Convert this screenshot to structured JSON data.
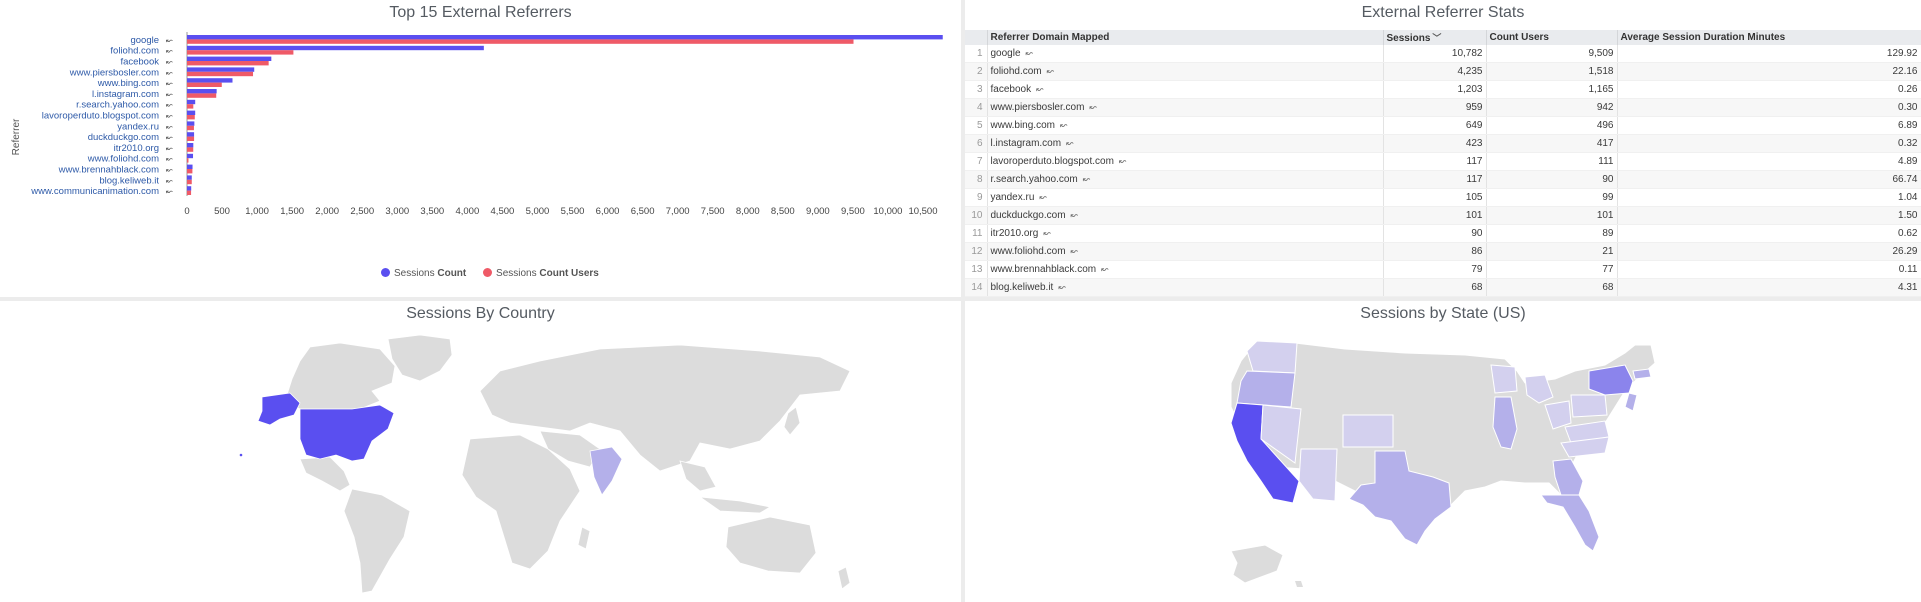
{
  "referrers_tile": {
    "title": "Top 15 External Referrers",
    "y_axis_label": "Referrer",
    "legend": [
      {
        "prefix": "Sessions",
        "bold": "Count",
        "color": "#5a4ff0"
      },
      {
        "prefix": "Sessions",
        "bold": "Count Users",
        "color": "#ef5a67"
      }
    ]
  },
  "chart_data": {
    "type": "bar",
    "orientation": "horizontal",
    "ylabel": "Referrer",
    "xlim": [
      0,
      10800
    ],
    "x_ticks": [
      "0",
      "500",
      "1,000",
      "1,500",
      "2,000",
      "2,500",
      "3,000",
      "3,500",
      "4,000",
      "4,500",
      "5,000",
      "5,500",
      "6,000",
      "6,500",
      "7,000",
      "7,500",
      "8,000",
      "8,500",
      "9,000",
      "9,500",
      "10,000",
      "10,500"
    ],
    "categories": [
      "google",
      "foliohd.com",
      "facebook",
      "www.piersbosler.com",
      "www.bing.com",
      "l.instagram.com",
      "r.search.yahoo.com",
      "lavoroperduto.blogspot.com",
      "yandex.ru",
      "duckduckgo.com",
      "itr2010.org",
      "www.foliohd.com",
      "www.brennahblack.com",
      "blog.keliweb.it",
      "www.communicanimation.com"
    ],
    "series": [
      {
        "name": "Sessions Count",
        "color": "#5a4ff0",
        "values": [
          10782,
          4235,
          1203,
          959,
          649,
          423,
          117,
          117,
          105,
          101,
          90,
          86,
          79,
          68,
          60
        ]
      },
      {
        "name": "Sessions Count Users",
        "color": "#ef5a67",
        "values": [
          9509,
          1518,
          1165,
          942,
          496,
          417,
          90,
          111,
          99,
          101,
          89,
          21,
          77,
          68,
          58
        ]
      }
    ]
  },
  "table_tile": {
    "title": "External Referrer Stats",
    "columns": [
      "Referrer Domain Mapped",
      "Sessions",
      "Count Users",
      "Average Session Duration Minutes"
    ],
    "rows": [
      {
        "idx": "1",
        "domain": "google",
        "sessions": "10,782",
        "users": "9,509",
        "avg": "129.92"
      },
      {
        "idx": "2",
        "domain": "foliohd.com",
        "sessions": "4,235",
        "users": "1,518",
        "avg": "22.16"
      },
      {
        "idx": "3",
        "domain": "facebook",
        "sessions": "1,203",
        "users": "1,165",
        "avg": "0.26"
      },
      {
        "idx": "4",
        "domain": "www.piersbosler.com",
        "sessions": "959",
        "users": "942",
        "avg": "0.30"
      },
      {
        "idx": "5",
        "domain": "www.bing.com",
        "sessions": "649",
        "users": "496",
        "avg": "6.89"
      },
      {
        "idx": "6",
        "domain": "l.instagram.com",
        "sessions": "423",
        "users": "417",
        "avg": "0.32"
      },
      {
        "idx": "7",
        "domain": "lavoroperduto.blogspot.com",
        "sessions": "117",
        "users": "111",
        "avg": "4.89"
      },
      {
        "idx": "8",
        "domain": "r.search.yahoo.com",
        "sessions": "117",
        "users": "90",
        "avg": "66.74"
      },
      {
        "idx": "9",
        "domain": "yandex.ru",
        "sessions": "105",
        "users": "99",
        "avg": "1.04"
      },
      {
        "idx": "10",
        "domain": "duckduckgo.com",
        "sessions": "101",
        "users": "101",
        "avg": "1.50"
      },
      {
        "idx": "11",
        "domain": "itr2010.org",
        "sessions": "90",
        "users": "89",
        "avg": "0.62"
      },
      {
        "idx": "12",
        "domain": "www.foliohd.com",
        "sessions": "86",
        "users": "21",
        "avg": "26.29"
      },
      {
        "idx": "13",
        "domain": "www.brennahblack.com",
        "sessions": "79",
        "users": "77",
        "avg": "0.11"
      },
      {
        "idx": "14",
        "domain": "blog.keliweb.it",
        "sessions": "68",
        "users": "68",
        "avg": "4.31"
      }
    ]
  },
  "country_tile": {
    "title": "Sessions By Country",
    "highlight_color": "#5a4ff0",
    "light_color": "#b4b0ea",
    "base_color": "#dcdcdc"
  },
  "state_tile": {
    "title": "Sessions by State (US)",
    "high_color": "#5a4ff0",
    "mid_color": "#b4b0ea",
    "low_color": "#d3d0ee",
    "base_color": "#dcdcdc"
  }
}
